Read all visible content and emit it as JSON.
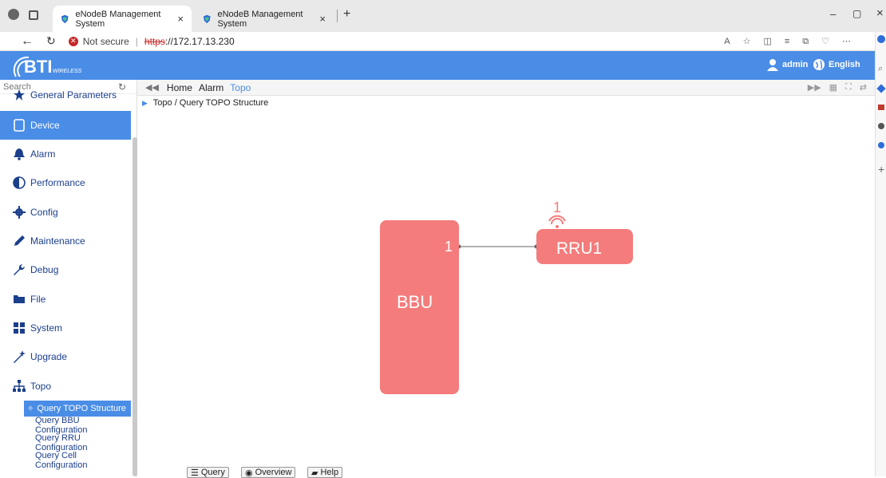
{
  "browser": {
    "tabs": [
      {
        "title": "eNodeB Management System",
        "close": "×"
      },
      {
        "title": "eNodeB Management System",
        "close": "×"
      }
    ],
    "new_tab": "+",
    "security_label": "Not secure",
    "url_scheme": "https",
    "url_rest": "://172.17.13.230",
    "window_minimize": "–",
    "window_restore": "▢",
    "window_close": "×"
  },
  "header": {
    "logo_text": "BTI",
    "logo_sub": "WIRELESS",
    "user_label": "admin",
    "language_label": "English"
  },
  "sidebar": {
    "search_placeholder": "Search",
    "items": [
      {
        "label": "General Parameters",
        "icon": "star-icon"
      },
      {
        "label": "Device",
        "icon": "tablet-icon"
      },
      {
        "label": "Alarm",
        "icon": "bell-icon"
      },
      {
        "label": "Performance",
        "icon": "half-circle-icon"
      },
      {
        "label": "Config",
        "icon": "gear-icon"
      },
      {
        "label": "Maintenance",
        "icon": "pencil-icon"
      },
      {
        "label": "Debug",
        "icon": "wrench-icon"
      },
      {
        "label": "File",
        "icon": "folder-icon"
      },
      {
        "label": "System",
        "icon": "grid-icon"
      },
      {
        "label": "Upgrade",
        "icon": "wand-icon"
      },
      {
        "label": "Topo",
        "icon": "sitemap-icon"
      }
    ],
    "topo_sub": [
      "Query TOPO Structure",
      "Query BBU Configuration",
      "Query RRU Configuration",
      "Query Cell Configuration"
    ]
  },
  "content_tabs": [
    "Home",
    "Alarm",
    "Topo"
  ],
  "breadcrumb": "Topo / Query TOPO Structure",
  "topology": {
    "bbu_label": "BBU",
    "bbu_port": "1",
    "rru_label": "RRU1",
    "rru_index": "1",
    "node_color": "#f47c7c"
  },
  "bottom_buttons": [
    "Query",
    "Overview",
    "Help"
  ],
  "colors": {
    "accent": "#4a8de6",
    "nav_text": "#1c3f8c",
    "node": "#f47c7c"
  }
}
